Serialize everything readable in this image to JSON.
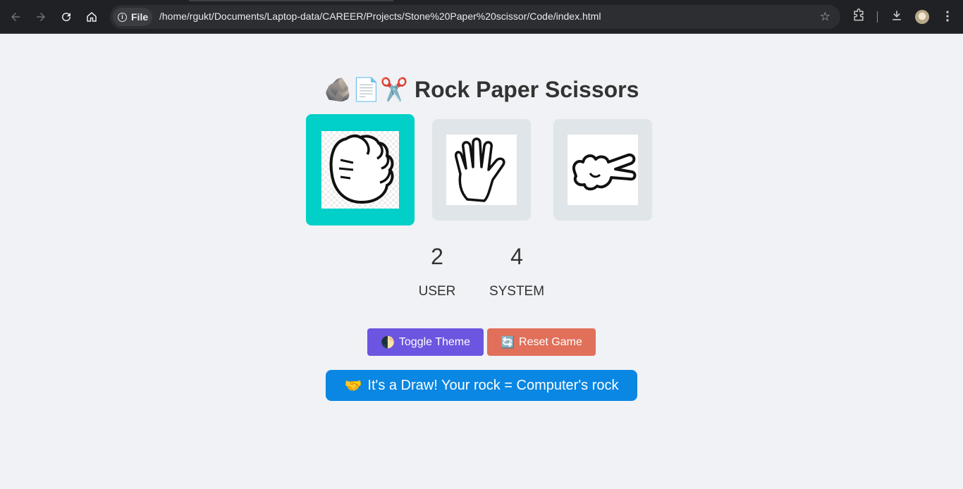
{
  "browser": {
    "scheme_chip": "File",
    "url": "/home/rgukt/Documents/Laptop-data/CAREER/Projects/Stone%20Paper%20scissor/Code/index.html",
    "icons": [
      "back-icon",
      "forward-icon",
      "reload-icon",
      "home-icon",
      "info-icon",
      "star-icon",
      "extensions-icon",
      "download-icon",
      "avatar",
      "menu-icon"
    ]
  },
  "page": {
    "title_emoji": "🪨📄✂️",
    "title_text": "Rock Paper Scissors",
    "choices": [
      {
        "name": "rock",
        "selected": true
      },
      {
        "name": "paper",
        "selected": false
      },
      {
        "name": "scissors",
        "selected": false
      }
    ],
    "scores": {
      "user_score": "2",
      "user_label": "USER",
      "system_score": "4",
      "system_label": "SYSTEM"
    },
    "buttons": {
      "theme_icon": "🌓",
      "theme_label": "Toggle Theme",
      "reset_icon": "🔄",
      "reset_label": "Reset Game"
    },
    "result": {
      "icon": "🤝",
      "text": "It's a Draw! Your rock = Computer's rock"
    },
    "colors": {
      "background": "#f0f2f5",
      "selected_card": "#00d0c8",
      "card": "#dfe5e8",
      "theme_button": "#6c55e0",
      "reset_button": "#e1705a",
      "result_banner": "#0a86e3"
    }
  }
}
